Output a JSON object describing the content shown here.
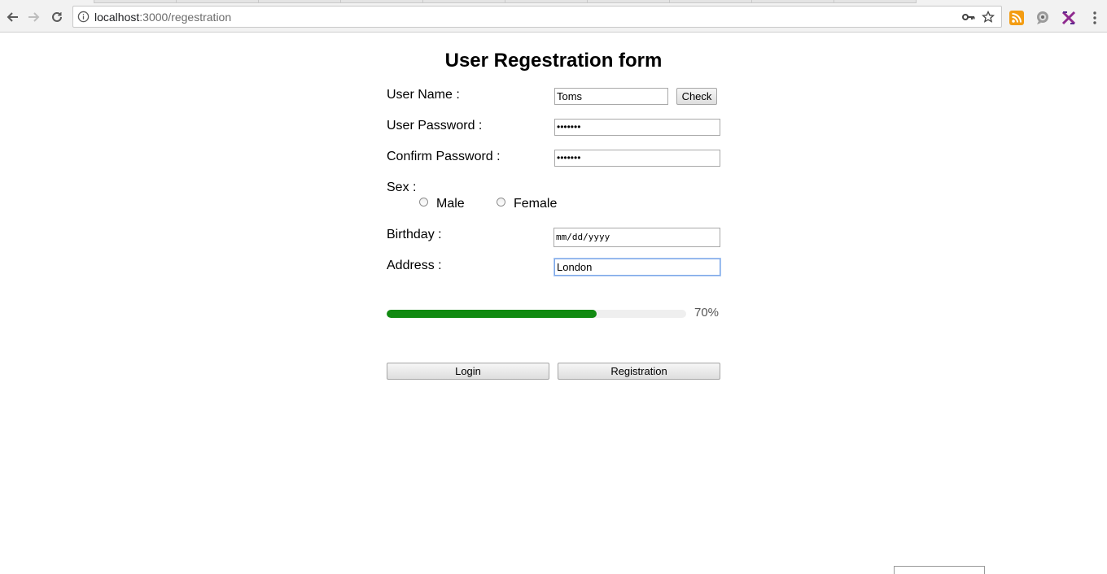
{
  "browser": {
    "url_host": "localhost",
    "url_rest": ":3000/regestration"
  },
  "form": {
    "title": "User Regestration form",
    "username_label": "User Name :",
    "username_value": "Toms",
    "check_label": "Check",
    "password_label": "User Password :",
    "password_value": "•••••••",
    "confirm_label": "Confirm Password :",
    "confirm_value": "•••••••",
    "sex_label": "Sex :",
    "sex_options": [
      "Male",
      "Female"
    ],
    "birthday_label": "Birthday :",
    "birthday_placeholder": "mm/dd/yyyy",
    "address_label": "Address :",
    "address_value": "London",
    "progress_value": 0.7,
    "progress_text": "70%",
    "login_label": "Login",
    "register_label": "Registration"
  },
  "colors": {
    "progress": "#118a11",
    "rss": "#f39c12",
    "ext_purple": "#8e2a8e"
  }
}
